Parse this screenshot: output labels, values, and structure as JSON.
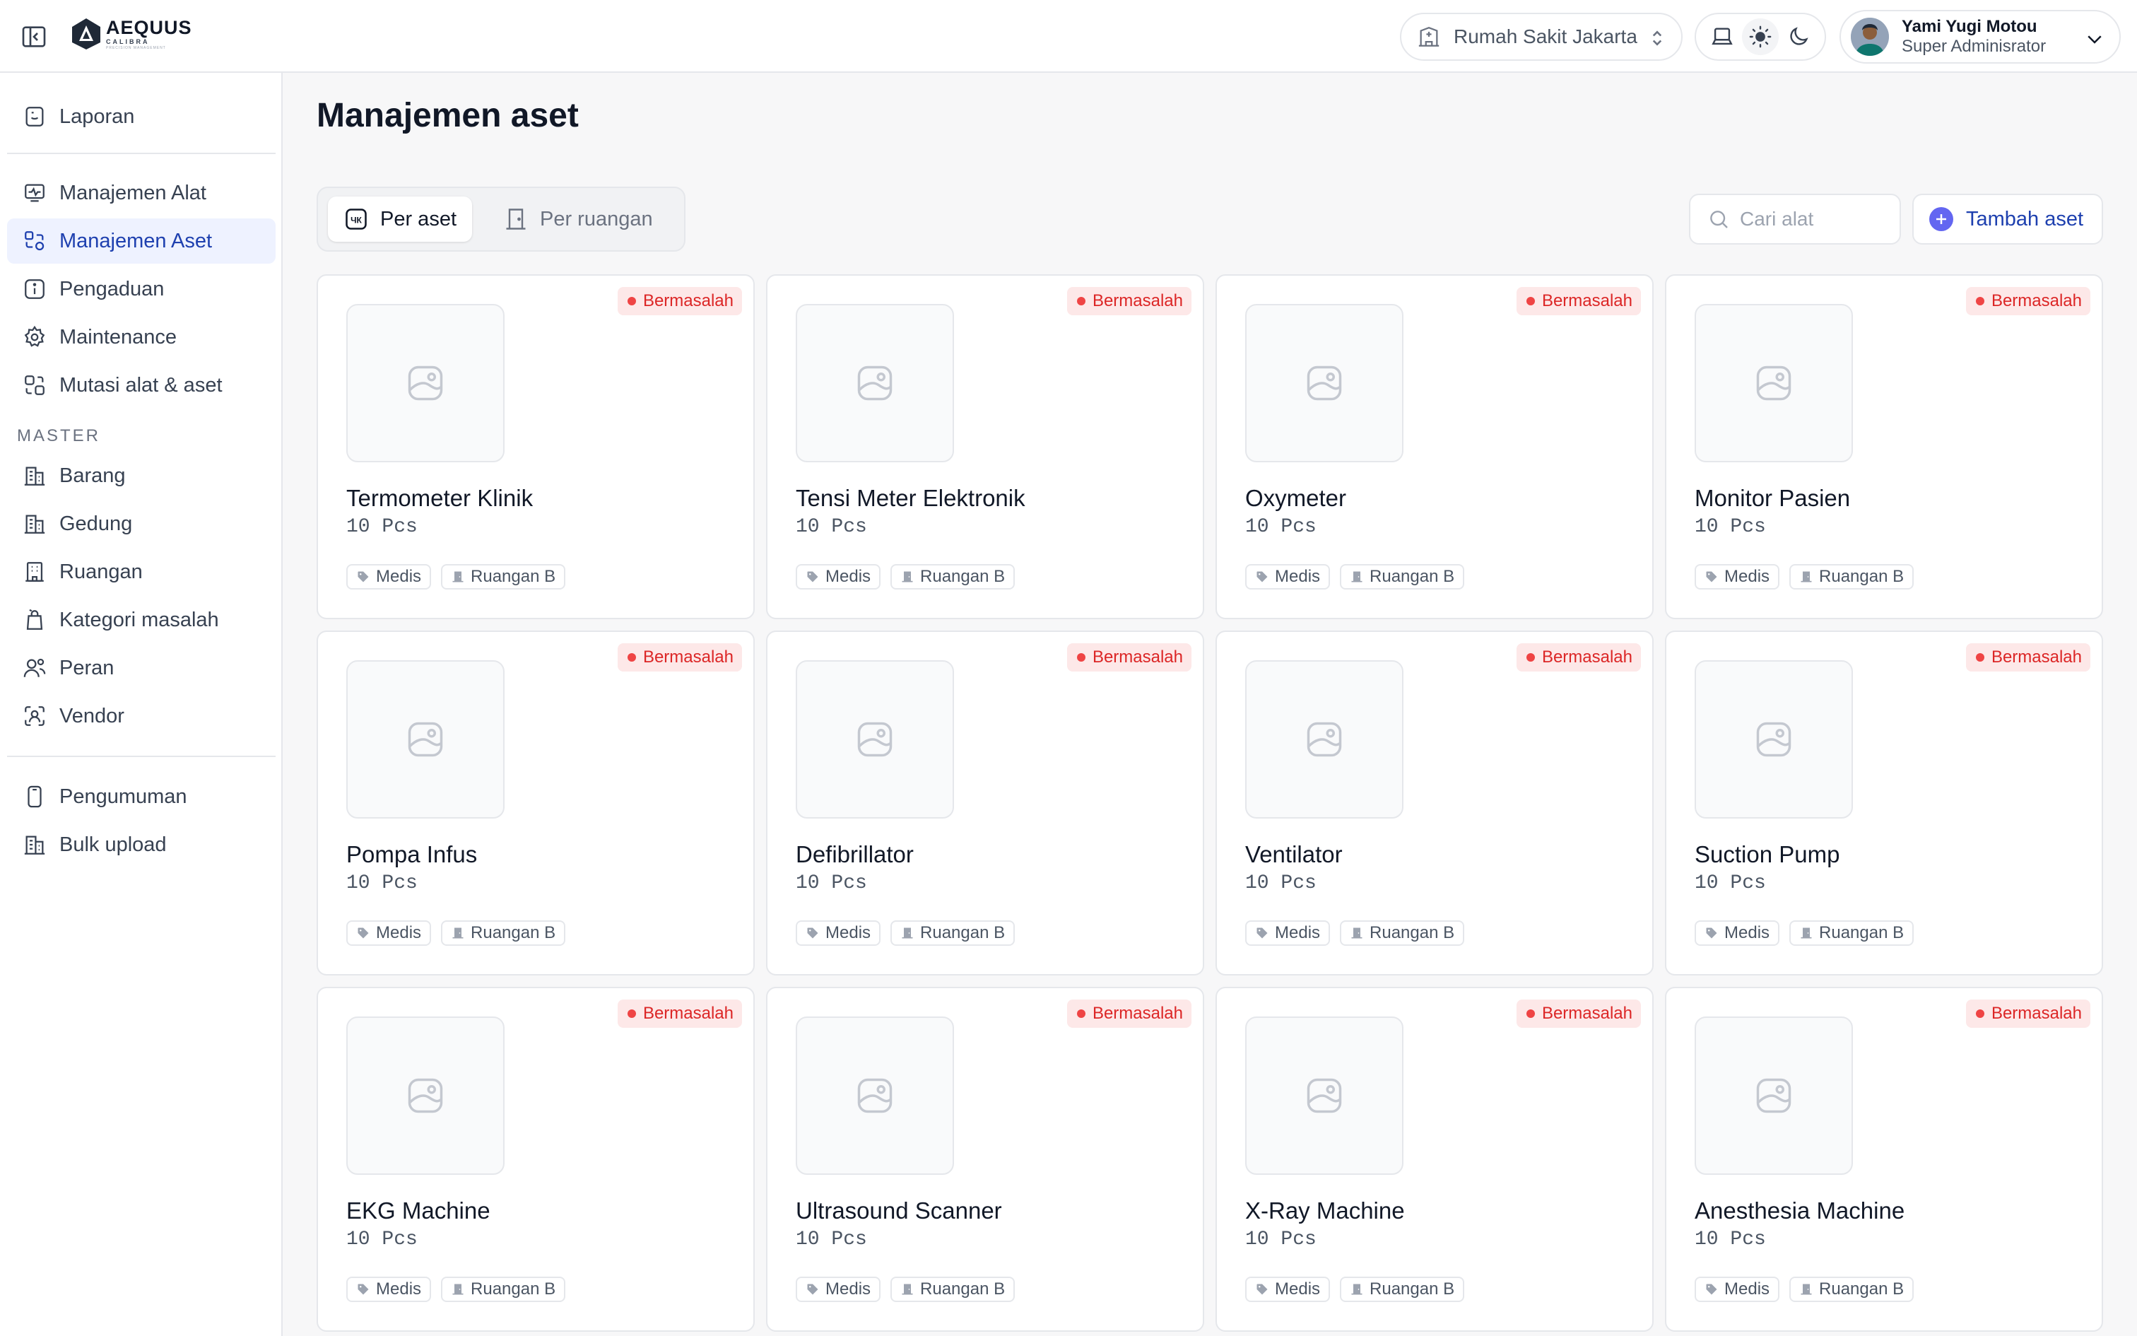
{
  "header": {
    "logo_main": "AEQUUS",
    "logo_sub": "CALIBRA",
    "logo_tiny": "PRECISION MANAGEMENT",
    "hospital": "Rumah Sakit Jakarta",
    "user_name": "Yami Yugi Motou",
    "user_role": "Super Adminisrator"
  },
  "sidebar": {
    "items": [
      {
        "label": "Laporan",
        "icon": "report-icon"
      },
      {
        "label": "Manajemen Alat",
        "icon": "monitor-icon"
      },
      {
        "label": "Manajemen Aset",
        "icon": "asset-icon",
        "active": true
      },
      {
        "label": "Pengaduan",
        "icon": "info-icon"
      },
      {
        "label": "Maintenance",
        "icon": "gear-icon"
      },
      {
        "label": "Mutasi alat & aset",
        "icon": "transfer-icon"
      }
    ],
    "master_label": "MASTER",
    "master_items": [
      {
        "label": "Barang",
        "icon": "building-icon"
      },
      {
        "label": "Gedung",
        "icon": "building-icon"
      },
      {
        "label": "Ruangan",
        "icon": "room-icon"
      },
      {
        "label": "Kategori masalah",
        "icon": "bag-icon"
      },
      {
        "label": "Peran",
        "icon": "users-icon"
      },
      {
        "label": "Vendor",
        "icon": "vendor-icon"
      }
    ],
    "bottom_items": [
      {
        "label": "Pengumuman",
        "icon": "phone-icon"
      },
      {
        "label": "Bulk upload",
        "icon": "building-icon"
      }
    ]
  },
  "main": {
    "title": "Manajemen aset",
    "tabs": [
      {
        "label": "Per aset",
        "active": true
      },
      {
        "label": "Per ruangan",
        "active": false
      }
    ],
    "search_placeholder": "Cari alat",
    "add_button": "Tambah aset"
  },
  "assets": [
    {
      "name": "Termometer Klinik",
      "qty": "10 Pcs",
      "status": "Bermasalah",
      "category": "Medis",
      "room": "Ruangan B"
    },
    {
      "name": "Tensi Meter Elektronik",
      "qty": "10 Pcs",
      "status": "Bermasalah",
      "category": "Medis",
      "room": "Ruangan B"
    },
    {
      "name": "Oxymeter",
      "qty": "10 Pcs",
      "status": "Bermasalah",
      "category": "Medis",
      "room": "Ruangan B"
    },
    {
      "name": "Monitor Pasien",
      "qty": "10 Pcs",
      "status": "Bermasalah",
      "category": "Medis",
      "room": "Ruangan B"
    },
    {
      "name": "Pompa Infus",
      "qty": "10 Pcs",
      "status": "Bermasalah",
      "category": "Medis",
      "room": "Ruangan B"
    },
    {
      "name": "Defibrillator",
      "qty": "10 Pcs",
      "status": "Bermasalah",
      "category": "Medis",
      "room": "Ruangan B"
    },
    {
      "name": "Ventilator",
      "qty": "10 Pcs",
      "status": "Bermasalah",
      "category": "Medis",
      "room": "Ruangan B"
    },
    {
      "name": "Suction Pump",
      "qty": "10 Pcs",
      "status": "Bermasalah",
      "category": "Medis",
      "room": "Ruangan B"
    },
    {
      "name": "EKG Machine",
      "qty": "10 Pcs",
      "status": "Bermasalah",
      "category": "Medis",
      "room": "Ruangan B"
    },
    {
      "name": "Ultrasound Scanner",
      "qty": "10 Pcs",
      "status": "Bermasalah",
      "category": "Medis",
      "room": "Ruangan B"
    },
    {
      "name": "X-Ray Machine",
      "qty": "10 Pcs",
      "status": "Bermasalah",
      "category": "Medis",
      "room": "Ruangan B"
    },
    {
      "name": "Anesthesia Machine",
      "qty": "10 Pcs",
      "status": "Bermasalah",
      "category": "Medis",
      "room": "Ruangan B"
    }
  ],
  "colors": {
    "accent": "#1e40af",
    "active_bg": "#eef2ff",
    "danger": "#dc2626",
    "danger_bg": "#fde8e8"
  }
}
